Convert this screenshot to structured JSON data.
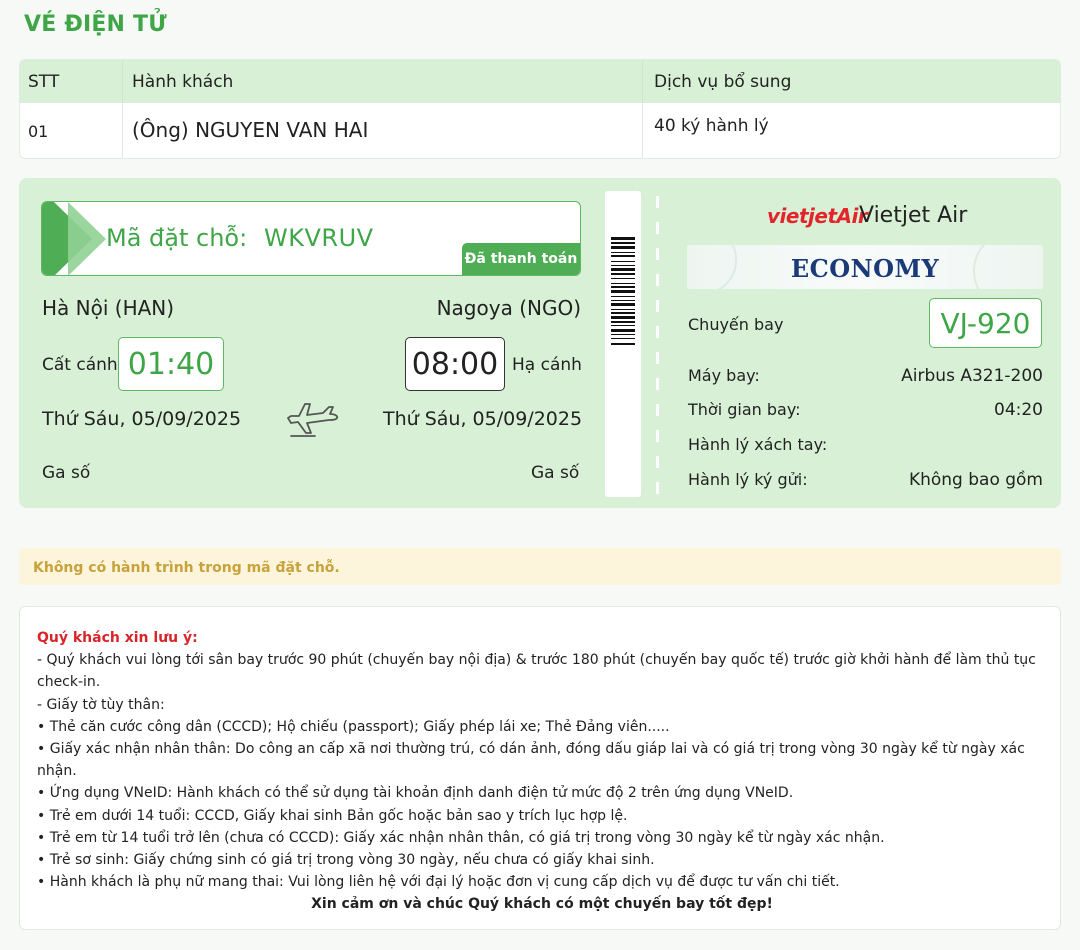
{
  "page": {
    "title": "VÉ ĐIỆN TỬ"
  },
  "passenger_table": {
    "headers": {
      "stt": "STT",
      "passenger": "Hành khách",
      "service": "Dịch vụ bổ sung"
    },
    "rows": [
      {
        "stt": "01",
        "title": "(Ông)",
        "name": "NGUYEN VAN HAI",
        "service": "40 ký hành lý"
      }
    ]
  },
  "ticket": {
    "booking_label": "Mã đặt chỗ:",
    "booking_code": "WKVRUV",
    "payment_status": "Đã thanh toán",
    "origin": "Hà Nội (HAN)",
    "destination": "Nagoya (NGO)",
    "departure_label": "Cất cánh",
    "departure_time": "01:40",
    "arrival_time": "08:00",
    "arrival_label": "Hạ cánh",
    "departure_date": "Thứ Sáu, 05/09/2025",
    "arrival_date": "Thứ Sáu, 05/09/2025",
    "departure_gate_label": "Ga số",
    "arrival_gate_label": "Ga số",
    "airline_logo": "vietjetAir",
    "airline_name": "Vietjet Air",
    "fare_class": "ECONOMY",
    "flight_label": "Chuyến bay",
    "flight_number": "VJ-920",
    "aircraft_label": "Máy bay:",
    "aircraft": "Airbus A321-200",
    "duration_label": "Thời gian bay:",
    "duration": "04:20",
    "carry_on_label": "Hành lý xách tay:",
    "carry_on": "",
    "checked_label": "Hành lý ký gửi:",
    "checked": "Không bao gồm",
    "accent_color": "#3fa648",
    "icons": {
      "plane": "plane-icon",
      "barcode": "barcode-icon"
    }
  },
  "alert": {
    "message": "Không có hành trình trong mã đặt chỗ."
  },
  "notes": {
    "title": "Quý khách xin lưu ý:",
    "line1": "- Quý khách vui lòng tới sân bay trước 90 phút (chuyến bay nội địa) & trước 180 phút (chuyến bay quốc tế) trước giờ khởi hành để làm thủ tục check-in.",
    "line2": "- Giấy tờ tùy thân:",
    "bullets": [
      "Thẻ căn cước công dân (CCCD); Hộ chiếu (passport); Giấy phép lái xe; Thẻ Đảng viên.....",
      "Giấy xác nhận nhân thân: Do công an cấp xã nơi thường trú, có dán ảnh, đóng dấu giáp lai và có giá trị trong vòng 30 ngày kể từ ngày xác nhận.",
      "Ứng dụng VNeID: Hành khách có thể sử dụng tài khoản định danh điện tử mức độ 2 trên ứng dụng VNeID.",
      "Trẻ em dưới 14 tuổi: CCCD, Giấy khai sinh Bản gốc hoặc bản sao y trích lục hợp lệ.",
      "Trẻ em từ 14 tuổi trở lên (chưa có CCCD): Giấy xác nhận nhân thân, có giá trị trong vòng 30 ngày kể từ ngày xác nhận.",
      "Trẻ sơ sinh: Giấy chứng sinh có giá trị trong vòng 30 ngày, nếu chưa có giấy khai sinh.",
      "Hành khách là phụ nữ mang thai: Vui lòng liên hệ với đại lý hoặc đơn vị cung cấp dịch vụ để được tư vấn chi tiết."
    ],
    "closing": "Xin cảm ơn và chúc Quý khách có một chuyến bay tốt đẹp!"
  }
}
